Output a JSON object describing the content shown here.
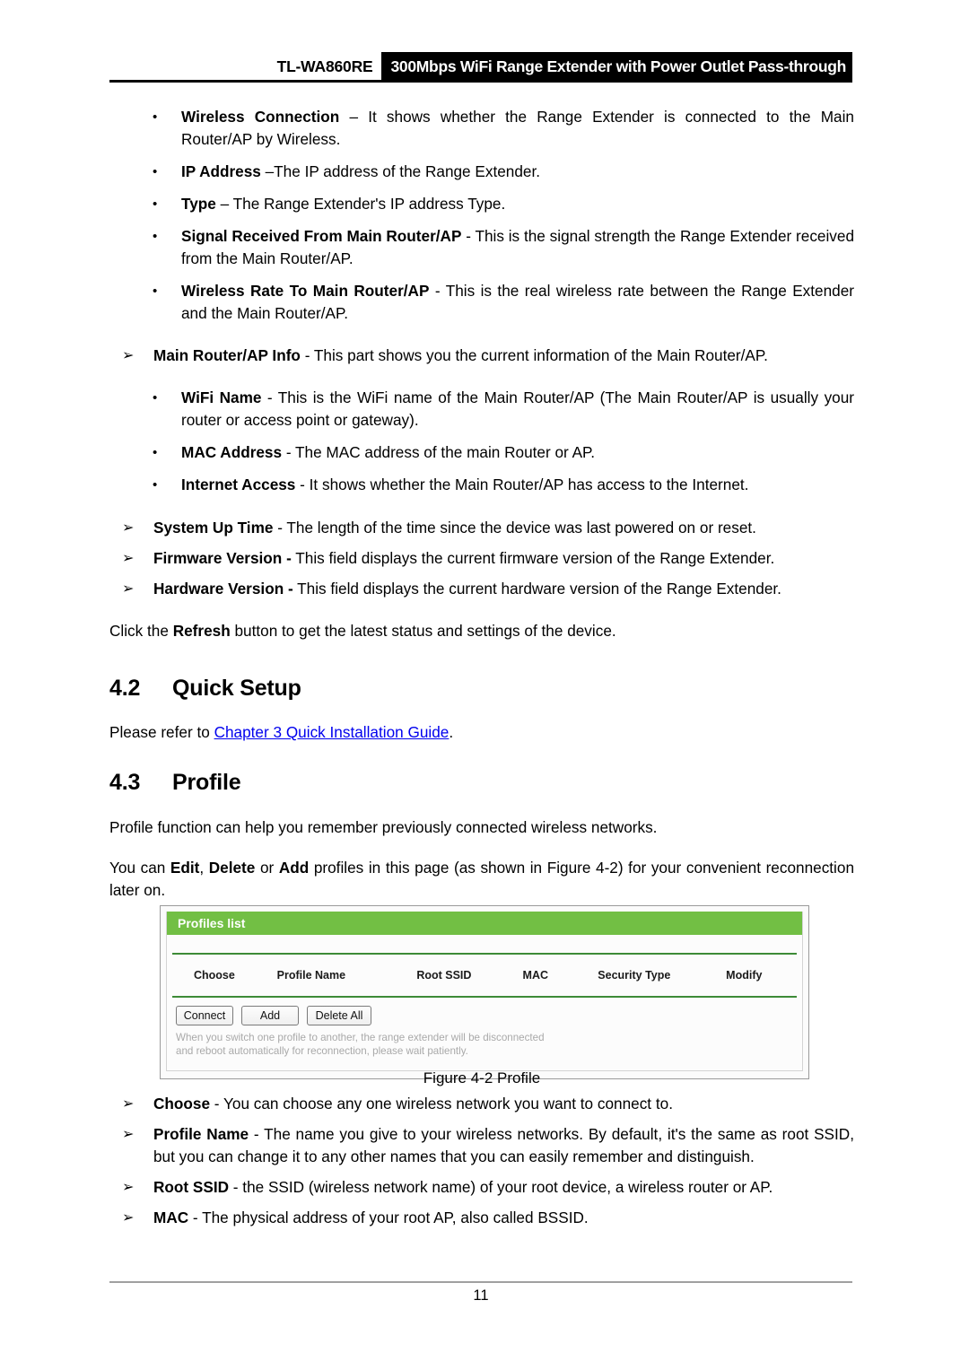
{
  "header": {
    "model": "TL-WA860RE",
    "tagline": "300Mbps WiFi Range Extender with Power Outlet Pass-through"
  },
  "status_bullets": [
    {
      "marker": "•",
      "term": "Wireless Connection",
      "rest": " – It shows whether the Range Extender is connected to the Main Router/AP by Wireless."
    },
    {
      "marker": "•",
      "term": "IP Address",
      "rest": " –The IP address of the Range Extender."
    },
    {
      "marker": "•",
      "term": "Type",
      "rest": " – The Range Extender's IP address Type."
    },
    {
      "marker": "•",
      "term": "Signal Received From Main Router/AP",
      "rest": " - This is the signal strength the Range Extender received from the Main Router/AP."
    },
    {
      "marker": "•",
      "term": "Wireless Rate To Main Router/AP",
      "rest": " - This is the real wireless rate between the Range Extender and the Main Router/AP."
    }
  ],
  "main_router_info": {
    "marker": "➢",
    "term": "Main Router/AP Info",
    "rest": " - This part shows you the current information of the Main Router/AP."
  },
  "router_bullets": [
    {
      "marker": "•",
      "term": "WiFi Name",
      "rest": " - This is the WiFi name of the Main Router/AP (The Main Router/AP is usually your router or access point or gateway)."
    },
    {
      "marker": "•",
      "term": "MAC Address",
      "rest": " - The MAC address of the main Router or AP."
    },
    {
      "marker": "•",
      "term": "Internet Access",
      "rest": " - It shows whether the Main Router/AP has access to the Internet."
    }
  ],
  "system_bullets": [
    {
      "marker": "➢",
      "term": "System Up Time",
      "rest": " - The length of the time since the device was last powered on or reset."
    },
    {
      "marker": "➢",
      "term": "Firmware Version -",
      "rest": " This field displays the current firmware version of the Range Extender."
    },
    {
      "marker": "➢",
      "term": "Hardware Version -",
      "rest": " This field displays the current hardware version of the Range Extender."
    }
  ],
  "refresh_para": {
    "pre": "Click the ",
    "bold": "Refresh",
    "post": " button to get the latest status and settings of the device."
  },
  "section_quick_setup": {
    "number": "4.2",
    "title": "Quick Setup",
    "body_pre": "Please refer to ",
    "link_text": "Chapter 3 Quick Installation Guide",
    "body_post": "."
  },
  "section_profile": {
    "number": "4.3",
    "title": "Profile",
    "para1": "Profile function can help you remember previously connected wireless networks.",
    "para2_pre": "You can ",
    "para2_b1": "Edit",
    "para2_mid1": ", ",
    "para2_b2": "Delete",
    "para2_mid2": " or ",
    "para2_b3": "Add",
    "para2_post": " profiles in this page (as shown in Figure 4-2) for your convenient reconnection later on."
  },
  "profiles_ui": {
    "title": "Profiles list",
    "columns": [
      "Choose",
      "Profile Name",
      "Root SSID",
      "MAC",
      "Security Type",
      "Modify"
    ],
    "buttons": [
      "Connect",
      "Add",
      "Delete All"
    ],
    "note_line1": "When you switch one profile to another, the range extender will be disconnected",
    "note_line2": "and reboot automatically for reconnection, please wait patiently.",
    "accent_color": "#72bf44",
    "divider_color": "#3d8b37"
  },
  "figure_caption": "Figure 4-2 Profile",
  "profile_bullets": [
    {
      "marker": "➢",
      "term": "Choose",
      "rest": " - You can choose any one wireless network you want to connect to."
    },
    {
      "marker": "➢",
      "term": "Profile Name",
      "rest": " - The name you give to your wireless networks. By default, it's the same as root SSID, but you can change it to any other names that you can easily remember and distinguish."
    },
    {
      "marker": "➢",
      "term": "Root SSID",
      "rest": " - the SSID (wireless network name) of your root device, a wireless router or AP."
    },
    {
      "marker": "➢",
      "term": "MAC",
      "rest": " - The physical address of your root AP, also called BSSID."
    }
  ],
  "footer": {
    "page_number": "11"
  }
}
